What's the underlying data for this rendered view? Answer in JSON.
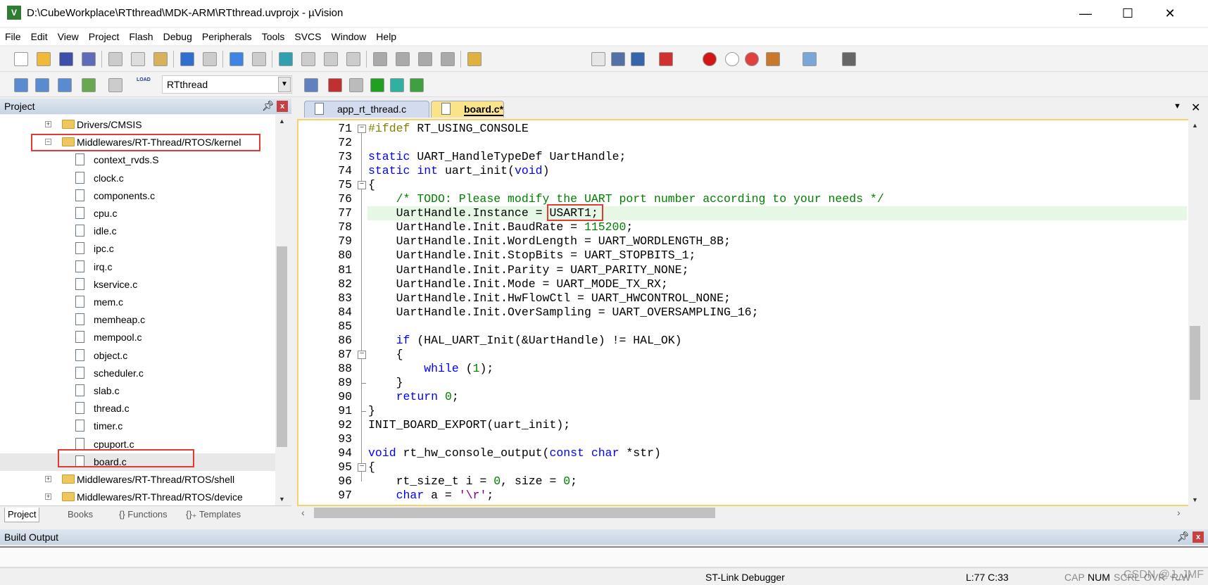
{
  "window": {
    "title": "D:\\CubeWorkplace\\RTthread\\MDK-ARM\\RTthread.uvprojx - µVision",
    "app_icon": "V"
  },
  "menu": [
    "File",
    "Edit",
    "View",
    "Project",
    "Flash",
    "Debug",
    "Peripherals",
    "Tools",
    "SVCS",
    "Window",
    "Help"
  ],
  "toolbar": {
    "target": "RTthread",
    "load_label": "LOAD"
  },
  "project": {
    "title": "Project",
    "tree": [
      {
        "label": "Drivers/CMSIS",
        "type": "folder",
        "expanded": false
      },
      {
        "label": "Middlewares/RT-Thread/RTOS/kernel",
        "type": "folder",
        "expanded": true
      },
      {
        "label": "context_rvds.S",
        "type": "file"
      },
      {
        "label": "clock.c",
        "type": "file"
      },
      {
        "label": "components.c",
        "type": "file"
      },
      {
        "label": "cpu.c",
        "type": "file"
      },
      {
        "label": "idle.c",
        "type": "file"
      },
      {
        "label": "ipc.c",
        "type": "file"
      },
      {
        "label": "irq.c",
        "type": "file"
      },
      {
        "label": "kservice.c",
        "type": "file"
      },
      {
        "label": "mem.c",
        "type": "file"
      },
      {
        "label": "memheap.c",
        "type": "file"
      },
      {
        "label": "mempool.c",
        "type": "file"
      },
      {
        "label": "object.c",
        "type": "file"
      },
      {
        "label": "scheduler.c",
        "type": "file"
      },
      {
        "label": "slab.c",
        "type": "file"
      },
      {
        "label": "thread.c",
        "type": "file"
      },
      {
        "label": "timer.c",
        "type": "file"
      },
      {
        "label": "cpuport.c",
        "type": "file"
      },
      {
        "label": "board.c",
        "type": "file",
        "selected": true
      },
      {
        "label": "Middlewares/RT-Thread/RTOS/shell",
        "type": "folder",
        "expanded": false
      },
      {
        "label": "Middlewares/RT-Thread/RTOS/device",
        "type": "folder",
        "expanded": false
      }
    ],
    "tabs": [
      "Project",
      "Books",
      "{} Functions",
      "{}₊ Templates"
    ]
  },
  "editor": {
    "tabs": [
      {
        "label": "app_rt_thread.c",
        "active": false
      },
      {
        "label": "board.c*",
        "active": true
      }
    ],
    "current_line": 77,
    "lines": [
      {
        "n": 71,
        "f": "open",
        "t": [
          [
            "p",
            "#ifdef"
          ],
          [
            "",
            " RT_USING_CONSOLE"
          ]
        ]
      },
      {
        "n": 72,
        "t": []
      },
      {
        "n": 73,
        "t": [
          [
            "k",
            "static"
          ],
          [
            "",
            " UART_HandleTypeDef UartHandle;"
          ]
        ]
      },
      {
        "n": 74,
        "t": [
          [
            "k",
            "static"
          ],
          [
            "",
            " "
          ],
          [
            "k",
            "int"
          ],
          [
            "",
            " uart_init("
          ],
          [
            "k",
            "void"
          ],
          [
            "",
            ")"
          ]
        ]
      },
      {
        "n": 75,
        "f": "open",
        "t": [
          [
            "",
            "{"
          ]
        ]
      },
      {
        "n": 76,
        "t": [
          [
            "",
            "    "
          ],
          [
            "c",
            "/* TODO: Please modify the UART port number according to your needs */"
          ]
        ]
      },
      {
        "n": 77,
        "t": [
          [
            "",
            "    UartHandle.Instance = USART1;"
          ]
        ]
      },
      {
        "n": 78,
        "t": [
          [
            "",
            "    UartHandle.Init.BaudRate = "
          ],
          [
            "n",
            "115200"
          ],
          [
            "",
            ";"
          ]
        ]
      },
      {
        "n": 79,
        "t": [
          [
            "",
            "    UartHandle.Init.WordLength = UART_WORDLENGTH_8B;"
          ]
        ]
      },
      {
        "n": 80,
        "t": [
          [
            "",
            "    UartHandle.Init.StopBits = UART_STOPBITS_1;"
          ]
        ]
      },
      {
        "n": 81,
        "t": [
          [
            "",
            "    UartHandle.Init.Parity = UART_PARITY_NONE;"
          ]
        ]
      },
      {
        "n": 82,
        "t": [
          [
            "",
            "    UartHandle.Init.Mode = UART_MODE_TX_RX;"
          ]
        ]
      },
      {
        "n": 83,
        "t": [
          [
            "",
            "    UartHandle.Init.HwFlowCtl = UART_HWCONTROL_NONE;"
          ]
        ]
      },
      {
        "n": 84,
        "t": [
          [
            "",
            "    UartHandle.Init.OverSampling = UART_OVERSAMPLING_16;"
          ]
        ]
      },
      {
        "n": 85,
        "t": []
      },
      {
        "n": 86,
        "t": [
          [
            "",
            "    "
          ],
          [
            "k",
            "if"
          ],
          [
            "",
            " (HAL_UART_Init(&UartHandle) != HAL_OK)"
          ]
        ]
      },
      {
        "n": 87,
        "f": "open",
        "t": [
          [
            "",
            "    {"
          ]
        ]
      },
      {
        "n": 88,
        "t": [
          [
            "",
            "        "
          ],
          [
            "k",
            "while"
          ],
          [
            "",
            " ("
          ],
          [
            "n",
            "1"
          ],
          [
            "",
            ");"
          ]
        ]
      },
      {
        "n": 89,
        "f": "end",
        "t": [
          [
            "",
            "    }"
          ]
        ]
      },
      {
        "n": 90,
        "t": [
          [
            "",
            "    "
          ],
          [
            "k",
            "return"
          ],
          [
            "",
            " "
          ],
          [
            "n",
            "0"
          ],
          [
            "",
            ";"
          ]
        ]
      },
      {
        "n": 91,
        "f": "end",
        "t": [
          [
            "",
            "}"
          ]
        ]
      },
      {
        "n": 92,
        "t": [
          [
            "",
            "INIT_BOARD_EXPORT(uart_init);"
          ]
        ]
      },
      {
        "n": 93,
        "t": []
      },
      {
        "n": 94,
        "t": [
          [
            "k",
            "void"
          ],
          [
            "",
            " rt_hw_console_output("
          ],
          [
            "k",
            "const"
          ],
          [
            "",
            " "
          ],
          [
            "k",
            "char"
          ],
          [
            "",
            " *str)"
          ]
        ]
      },
      {
        "n": 95,
        "f": "open",
        "t": [
          [
            "",
            "{"
          ]
        ]
      },
      {
        "n": 96,
        "t": [
          [
            "",
            "    rt_size_t i = "
          ],
          [
            "n",
            "0"
          ],
          [
            "",
            ", size = "
          ],
          [
            "n",
            "0"
          ],
          [
            "",
            ";"
          ]
        ]
      },
      {
        "n": 97,
        "t": [
          [
            "",
            "    "
          ],
          [
            "k",
            "char"
          ],
          [
            "",
            " a = "
          ],
          [
            "s",
            "'\\r'"
          ],
          [
            "",
            ";"
          ]
        ]
      }
    ]
  },
  "build_output": {
    "title": "Build Output"
  },
  "status": {
    "debugger": "ST-Link Debugger",
    "position": "L:77 C:33",
    "cap": "CAP",
    "num": "NUM",
    "scrl": "SCRL",
    "ovr": "OVR",
    "rw": "R/W"
  },
  "watermark": "CSDN @J_JMF",
  "colors": {
    "keyword": "#0000ff",
    "comment": "#008000",
    "highlight_line": "#e6f7e6",
    "annotation_box": "#e53935"
  }
}
